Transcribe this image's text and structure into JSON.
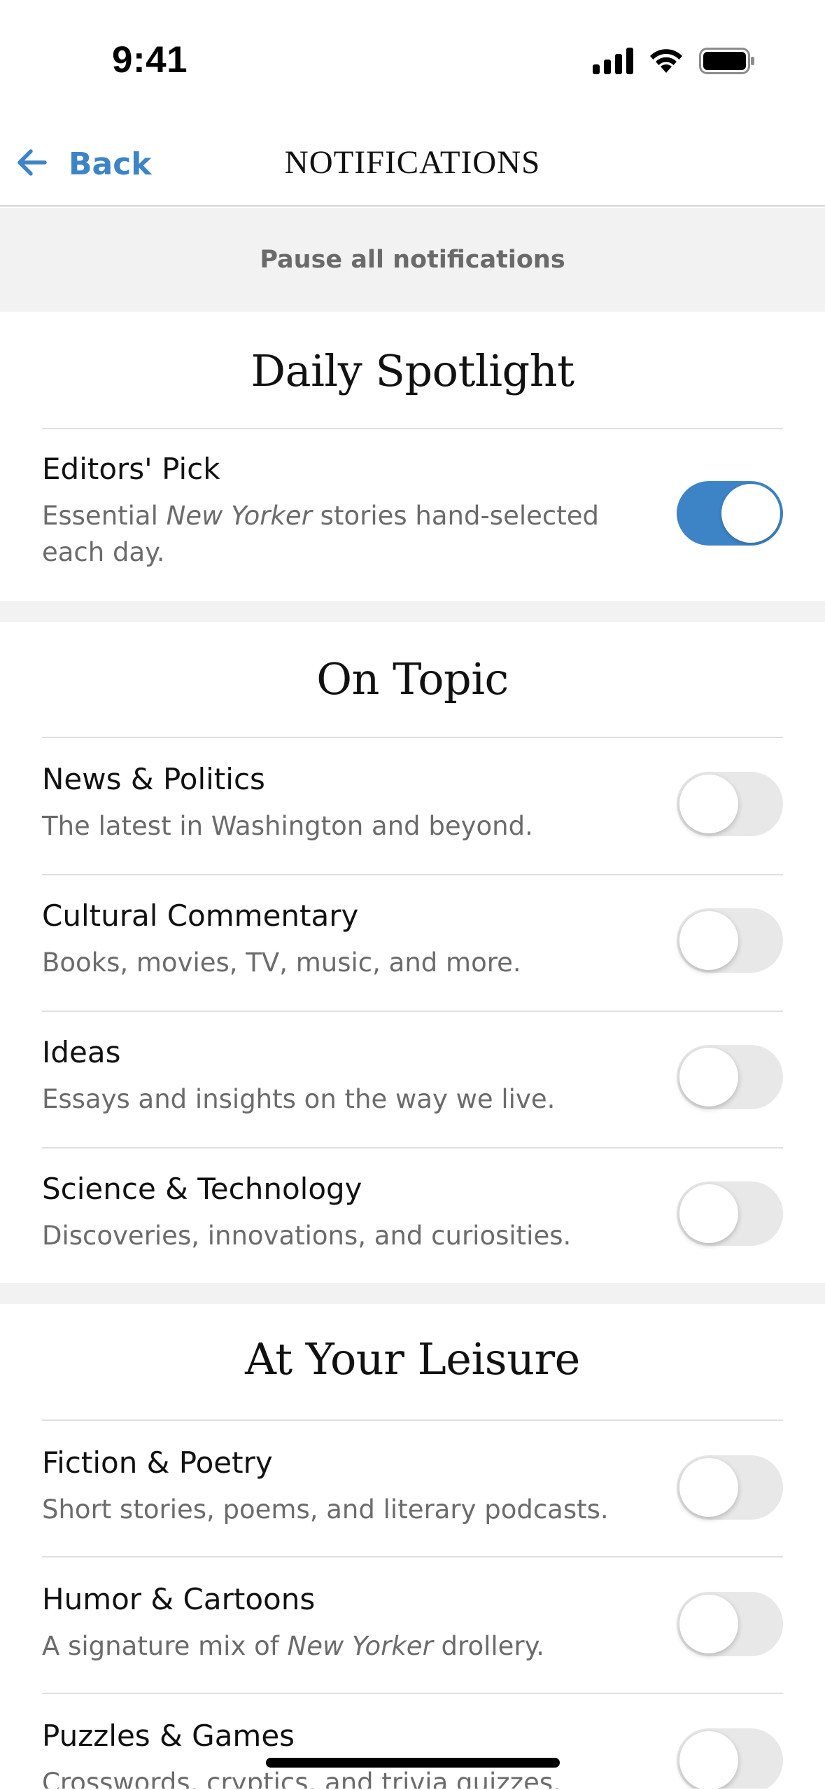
{
  "status_bar": {
    "time": "9:41",
    "icons": [
      "cellular-signal-icon",
      "wifi-icon",
      "battery-icon"
    ]
  },
  "nav": {
    "back_label": "Back",
    "back_icon": "arrow-left-icon",
    "title": "NOTIFICATIONS"
  },
  "pause_banner": {
    "label": "Pause all notifications"
  },
  "sections": [
    {
      "title": "Daily Spotlight",
      "items": [
        {
          "title": "Editors' Pick",
          "desc_before": "Essential ",
          "desc_emphasis": "New Yorker",
          "desc_after": " stories hand-selected each day.",
          "enabled": true
        }
      ]
    },
    {
      "title": "On Topic",
      "items": [
        {
          "title": "News & Politics",
          "desc": "The latest in Washington and beyond.",
          "enabled": false
        },
        {
          "title": "Cultural Commentary",
          "desc": "Books, movies, TV, music, and more.",
          "enabled": false
        },
        {
          "title": "Ideas",
          "desc": "Essays and insights on the way we live.",
          "enabled": false
        },
        {
          "title": "Science & Technology",
          "desc": "Discoveries, innovations, and curiosities.",
          "enabled": false
        }
      ]
    },
    {
      "title": "At Your Leisure",
      "items": [
        {
          "title": "Fiction & Poetry",
          "desc": "Short stories, poems, and literary podcasts.",
          "enabled": false
        },
        {
          "title": "Humor & Cartoons",
          "desc_before": "A signature mix of ",
          "desc_emphasis": "New Yorker",
          "desc_after": " drollery.",
          "enabled": false
        },
        {
          "title": "Puzzles & Games",
          "desc": "Crosswords, cryptics, and trivia quizzes.",
          "enabled": false
        }
      ]
    }
  ],
  "colors": {
    "accent": "#3d84c6",
    "toggle_off": "#e8e8e8",
    "section_gap": "#f2f2f2",
    "secondary_text": "#6b6b6b"
  }
}
